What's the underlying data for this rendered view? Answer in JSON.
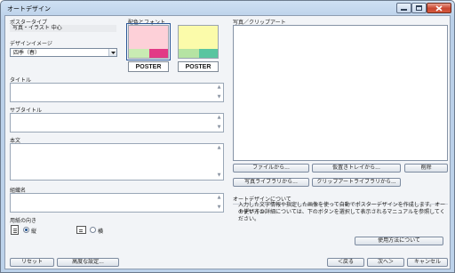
{
  "window": {
    "title": "オートデザイン"
  },
  "poster_type": {
    "label": "ポスタータイプ",
    "value": "写真・イラスト 中心"
  },
  "design_image": {
    "label": "デザインイメージ",
    "value": "四季（春）"
  },
  "color_font": {
    "label": "配色とフォント",
    "swatches": [
      {
        "label": "POSTER",
        "top": "#fdd0d8",
        "bottom_left": "#c9ebb3",
        "bottom_right": "#e23a86",
        "selected": true
      },
      {
        "label": "POSTER",
        "top": "#fbfbaa",
        "bottom_left": "#b5e3a3",
        "bottom_right": "#59c5a0",
        "selected": false
      }
    ]
  },
  "fields": {
    "title": {
      "label": "タイトル",
      "value": ""
    },
    "subtitle": {
      "label": "サブタイトル",
      "value": ""
    },
    "body": {
      "label": "本文",
      "value": ""
    },
    "org": {
      "label": "組織名",
      "value": ""
    }
  },
  "orientation": {
    "label": "用紙の向き",
    "portrait_label": "縦",
    "landscape_label": "横",
    "selected": "portrait"
  },
  "clipart": {
    "label": "写真／クリップアート",
    "from_file": "ファイルから...",
    "from_tray": "仮置きトレイから...",
    "delete": "削除",
    "photo_library": "写真ライブラリから...",
    "clipart_library": "クリップアートライブラリから..."
  },
  "about": {
    "heading": "オートデザインについて",
    "text1": "入力した文字情報や指定した画像を使って自動でポスターデザインを作成します。オートデザイン",
    "text2": "の使い方の詳細については、下のボタンを選択して表示されるマニュアルを参照してください。",
    "howto_button": "使用方法について"
  },
  "footer": {
    "reset": "リセット",
    "advanced": "高度な設定...",
    "back": "＜戻る",
    "next": "次へ＞",
    "cancel": "キャンセル"
  },
  "colors": {
    "accent": "#2b5797",
    "chrome": "#bcd2ea",
    "panel": "#f2f4f7"
  }
}
